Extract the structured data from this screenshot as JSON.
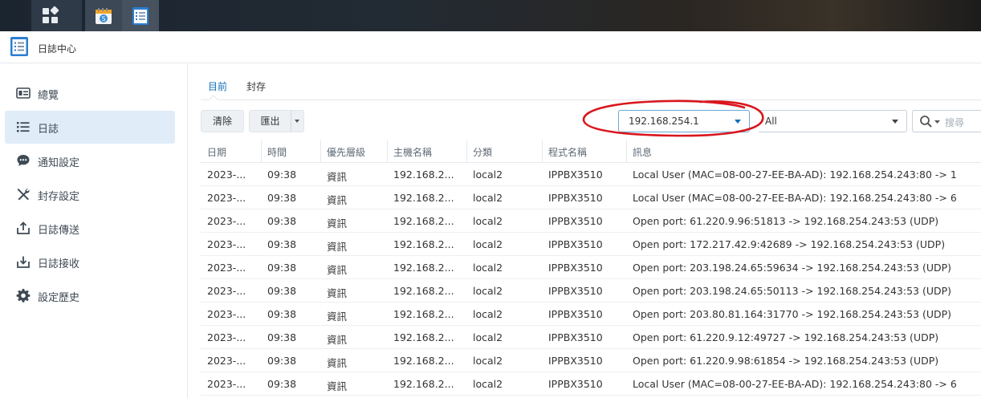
{
  "taskbar": {
    "items": [
      {
        "icon": "main-menu-grid-icon"
      },
      {
        "icon": "notepad-app-icon"
      },
      {
        "icon": "log-center-app-icon"
      }
    ]
  },
  "window": {
    "title": "日誌中心",
    "icon": "log-center-icon"
  },
  "sidebar": {
    "items": [
      {
        "label": "總覽",
        "icon": "overview-icon"
      },
      {
        "label": "日誌",
        "icon": "list-icon",
        "active": true
      },
      {
        "label": "通知設定",
        "icon": "chat-bubble-icon"
      },
      {
        "label": "封存設定",
        "icon": "tools-icon"
      },
      {
        "label": "日誌傳送",
        "icon": "upload-icon"
      },
      {
        "label": "日誌接收",
        "icon": "receive-icon"
      },
      {
        "label": "設定歷史",
        "icon": "gear-icon"
      }
    ]
  },
  "tabs": [
    {
      "label": "目前",
      "active": true
    },
    {
      "label": "封存"
    }
  ],
  "toolbar": {
    "clear_label": "清除",
    "export_label": "匯出",
    "source_filter": "192.168.254.1",
    "level_filter": "All",
    "search_placeholder": "搜尋"
  },
  "colors": {
    "accent": "#0f6fb8",
    "annotation": "#d9161c",
    "active_nav": "#e0ecf8"
  },
  "table": {
    "columns": [
      "日期",
      "時間",
      "優先層級",
      "主機名稱",
      "分類",
      "程式名稱",
      "訊息"
    ],
    "rows": [
      [
        "2023-...",
        "09:38",
        "資訊",
        "192.168.2...",
        "local2",
        "IPPBX3510",
        "Local User (MAC=08-00-27-EE-BA-AD): 192.168.254.243:80 -> 1"
      ],
      [
        "2023-...",
        "09:38",
        "資訊",
        "192.168.2...",
        "local2",
        "IPPBX3510",
        "Local User (MAC=08-00-27-EE-BA-AD): 192.168.254.243:80 -> 6"
      ],
      [
        "2023-...",
        "09:38",
        "資訊",
        "192.168.2...",
        "local2",
        "IPPBX3510",
        "Open port: 61.220.9.96:51813 -> 192.168.254.243:53 (UDP)"
      ],
      [
        "2023-...",
        "09:38",
        "資訊",
        "192.168.2...",
        "local2",
        "IPPBX3510",
        "Open port: 172.217.42.9:42689 -> 192.168.254.243:53 (UDP)"
      ],
      [
        "2023-...",
        "09:38",
        "資訊",
        "192.168.2...",
        "local2",
        "IPPBX3510",
        "Open port: 203.198.24.65:59634 -> 192.168.254.243:53 (UDP)"
      ],
      [
        "2023-...",
        "09:38",
        "資訊",
        "192.168.2...",
        "local2",
        "IPPBX3510",
        "Open port: 203.198.24.65:50113 -> 192.168.254.243:53 (UDP)"
      ],
      [
        "2023-...",
        "09:38",
        "資訊",
        "192.168.2...",
        "local2",
        "IPPBX3510",
        "Open port: 203.80.81.164:31770 -> 192.168.254.243:53 (UDP)"
      ],
      [
        "2023-...",
        "09:38",
        "資訊",
        "192.168.2...",
        "local2",
        "IPPBX3510",
        "Open port: 61.220.9.12:49727 -> 192.168.254.243:53 (UDP)"
      ],
      [
        "2023-...",
        "09:38",
        "資訊",
        "192.168.2...",
        "local2",
        "IPPBX3510",
        "Open port: 61.220.9.98:61854 -> 192.168.254.243:53 (UDP)"
      ],
      [
        "2023-...",
        "09:38",
        "資訊",
        "192.168.2...",
        "local2",
        "IPPBX3510",
        "Local User (MAC=08-00-27-EE-BA-AD): 192.168.254.243:80 -> 6"
      ]
    ]
  }
}
